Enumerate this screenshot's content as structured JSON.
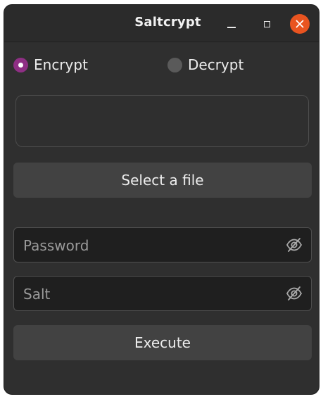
{
  "window": {
    "title": "Saltcrypt"
  },
  "titlebar_buttons": {
    "minimize_icon": "minimize-icon",
    "maximize_icon": "maximize-icon",
    "close_icon": "close-icon",
    "close_color": "#e95420"
  },
  "mode": {
    "encrypt_label": "Encrypt",
    "decrypt_label": "Decrypt",
    "selected": "Encrypt",
    "accent": "#8e2f84"
  },
  "message_area": {
    "value": ""
  },
  "select_file": {
    "label": "Select a file"
  },
  "password": {
    "placeholder": "Password",
    "value": "",
    "toggle_icon": "eye-hidden-icon"
  },
  "salt": {
    "placeholder": "Salt",
    "value": "",
    "toggle_icon": "eye-hidden-icon"
  },
  "execute": {
    "label": "Execute"
  }
}
